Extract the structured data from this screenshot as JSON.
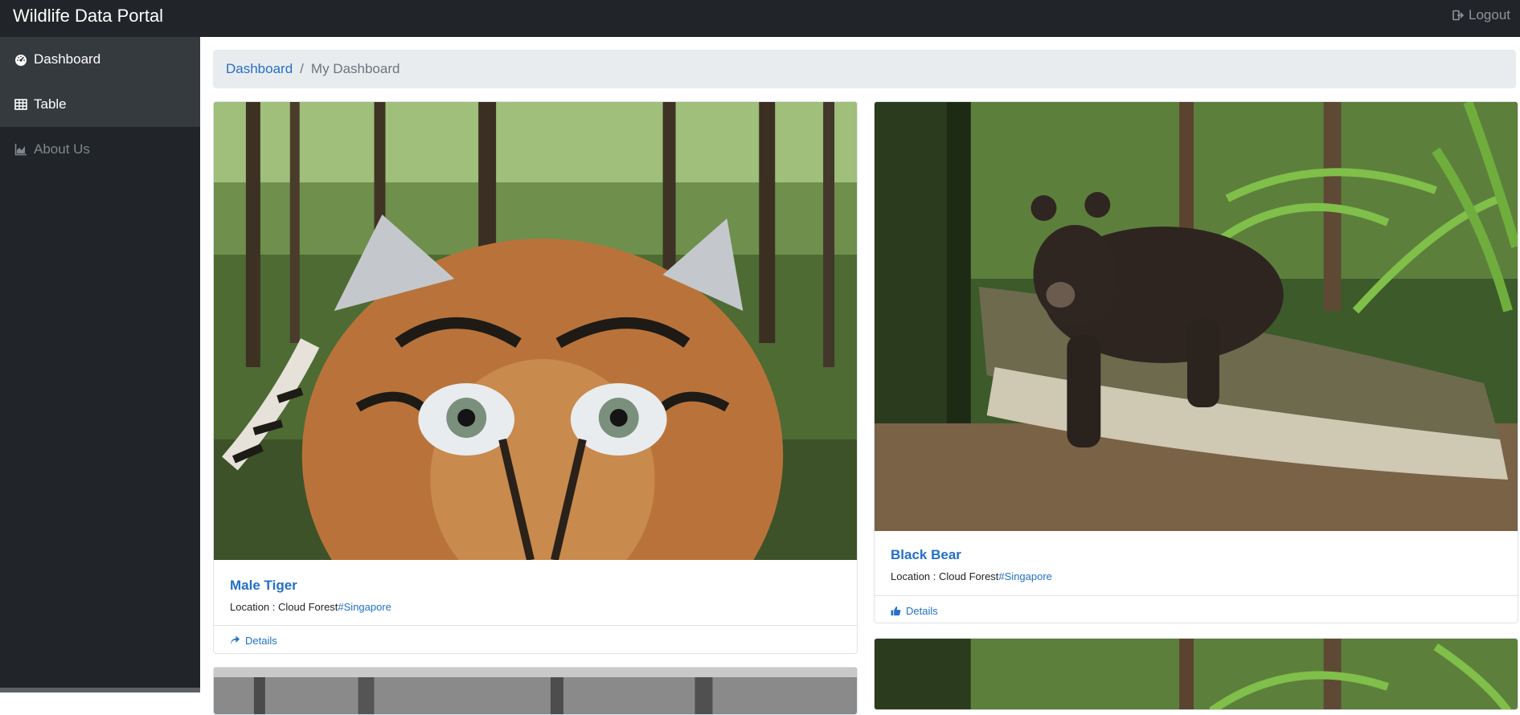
{
  "app": {
    "title": "Wildlife Data Portal",
    "logout_label": "Logout",
    "logout_icon": "sign-out-icon"
  },
  "sidebar": {
    "items": [
      {
        "label": "Dashboard",
        "icon": "tachometer-icon",
        "state": "active"
      },
      {
        "label": "Table",
        "icon": "table-icon",
        "state": "active"
      },
      {
        "label": "About Us",
        "icon": "area-chart-icon",
        "state": "muted"
      }
    ]
  },
  "breadcrumb": {
    "root": "Dashboard",
    "separator": "/",
    "current": "My Dashboard"
  },
  "cards": [
    {
      "title": "Male Tiger",
      "location_prefix": "Location : Cloud Forest",
      "location_tag": "#Singapore",
      "details_label": "Details",
      "details_icon": "share-icon",
      "photo": "tiger-photo"
    },
    {
      "title": "Black Bear",
      "location_prefix": "Location : Cloud Forest",
      "location_tag": "#Singapore",
      "details_label": "Details",
      "details_icon": "thumbs-up-icon",
      "photo": "black-bear-photo"
    }
  ],
  "colors": {
    "topbar": "#212529",
    "accent": "#2370c7",
    "breadcrumb_bg": "#e9ecef"
  }
}
